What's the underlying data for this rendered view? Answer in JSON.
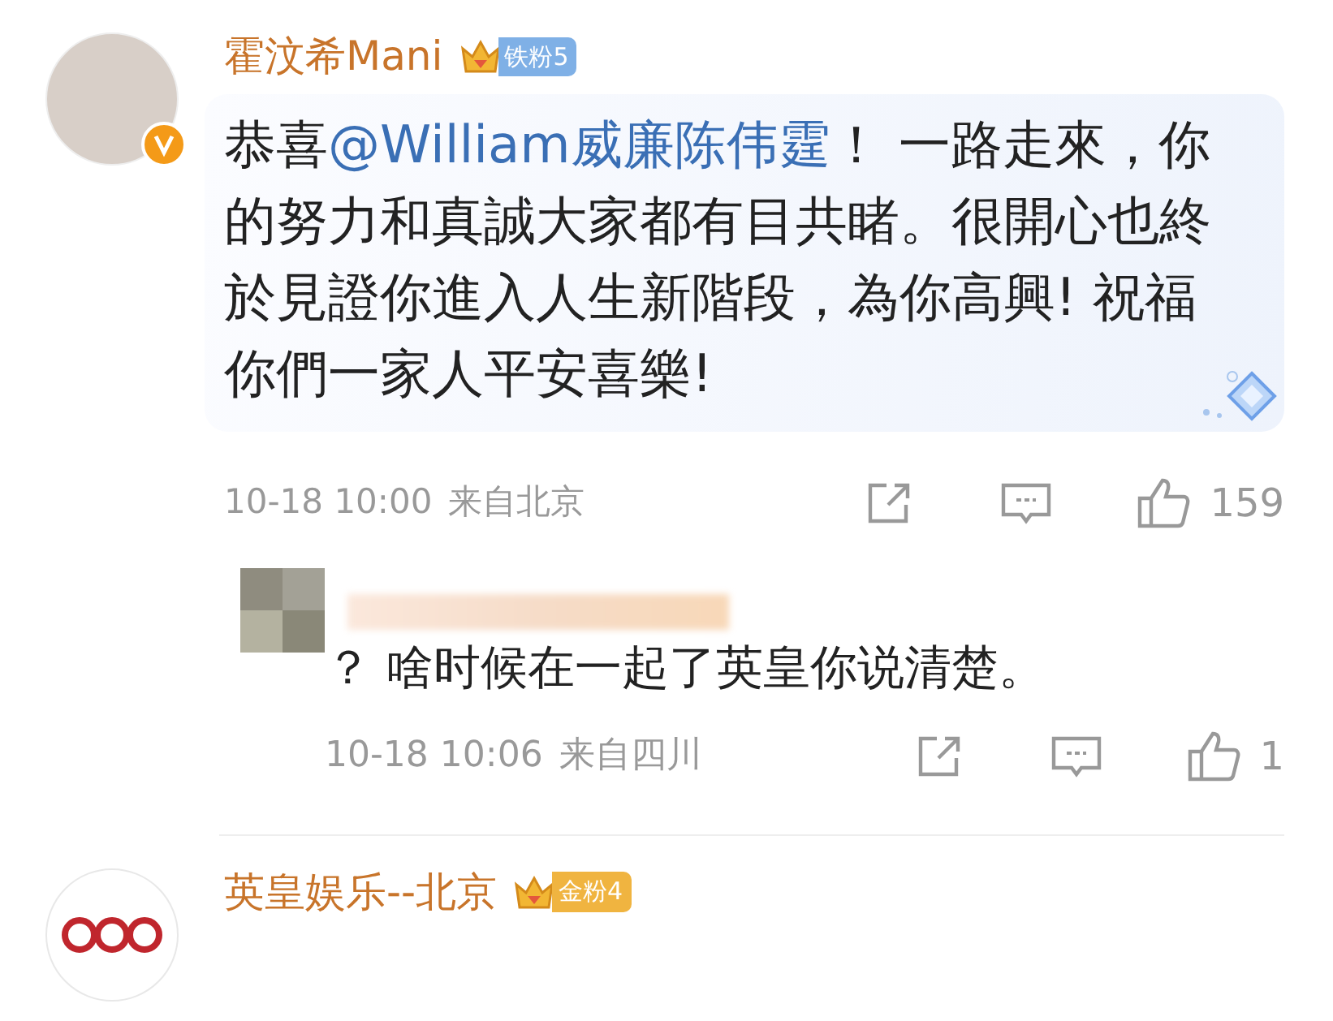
{
  "comments": [
    {
      "kind": "main",
      "avatar": {
        "kind": "photo"
      },
      "verified": true,
      "author": "霍汶希Mani",
      "badge": {
        "kind": "iron",
        "label": "铁粉5"
      },
      "text_parts": [
        {
          "kind": "text",
          "text": "恭喜"
        },
        {
          "kind": "mention",
          "text": "@William威廉陈伟霆"
        },
        {
          "kind": "text",
          "text": "！ 一路走來，你的努力和真誠大家都有目共睹。很開心也終於見證你進入人生新階段，為你高興! 祝福你們一家人平安喜樂!"
        }
      ],
      "time": "10-18 10:00",
      "location": "来自北京",
      "likes": "159"
    },
    {
      "kind": "reply",
      "avatar": {
        "kind": "pixelated"
      },
      "verified": false,
      "author_hidden": true,
      "text_parts": [
        {
          "kind": "text",
          "text": "？ 啥时候在一起了英皇你说清楚。"
        }
      ],
      "time": "10-18 10:06",
      "location": "来自四川",
      "likes": "1"
    },
    {
      "kind": "main",
      "avatar": {
        "kind": "logo"
      },
      "verified": false,
      "author": "英皇娱乐--北京",
      "badge": {
        "kind": "gold",
        "label": "金粉4"
      }
    }
  ]
}
